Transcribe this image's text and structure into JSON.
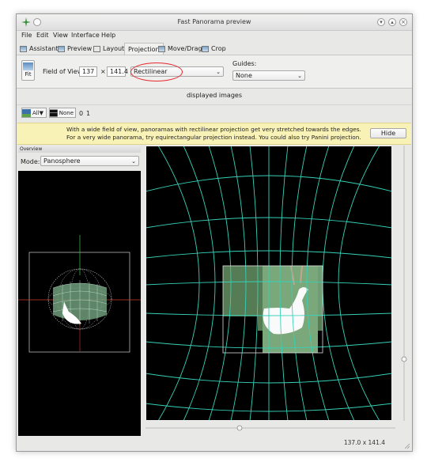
{
  "window": {
    "title": "Fast Panorama preview"
  },
  "menu": [
    "File",
    "Edit",
    "View",
    "Interface",
    "Help"
  ],
  "tabs": [
    {
      "label": "Assistant",
      "icon": "assistant-icon"
    },
    {
      "label": "Preview",
      "icon": "preview-icon"
    },
    {
      "label": "Layout",
      "icon": "layout-icon"
    },
    {
      "label": "Projection",
      "icon": "",
      "active": true
    },
    {
      "label": "Move/Drag",
      "icon": "move-drag-icon"
    },
    {
      "label": "Crop",
      "icon": "crop-icon"
    }
  ],
  "toolbar": {
    "fit_label": "Fit",
    "fov_label": "Field of View:",
    "fov_h": "137",
    "times": "×",
    "fov_v": "141.4",
    "projection": "Rectilinear",
    "guides_label": "Guides:",
    "guides_value": "None"
  },
  "displayed_images": {
    "label": "displayed images"
  },
  "image_buttons": {
    "all": "All▼",
    "none": "None",
    "img0": "0",
    "img1": "1"
  },
  "warning": {
    "line1": "With a wide field of view, panoramas with rectilinear projection get very stretched towards the edges.",
    "line2": "For a very wide panorama, try equirectangular projection instead. You could also try Panini projection.",
    "hide": "Hide"
  },
  "overview": {
    "title": "Overview",
    "mode_label": "Mode:",
    "mode_value": "Panosphere"
  },
  "status": {
    "fov": "137.0 x 141.4"
  },
  "colors": {
    "grid": "#36d1b8",
    "annotation": "#e8282d",
    "warning_bg": "#f9f2b7"
  }
}
